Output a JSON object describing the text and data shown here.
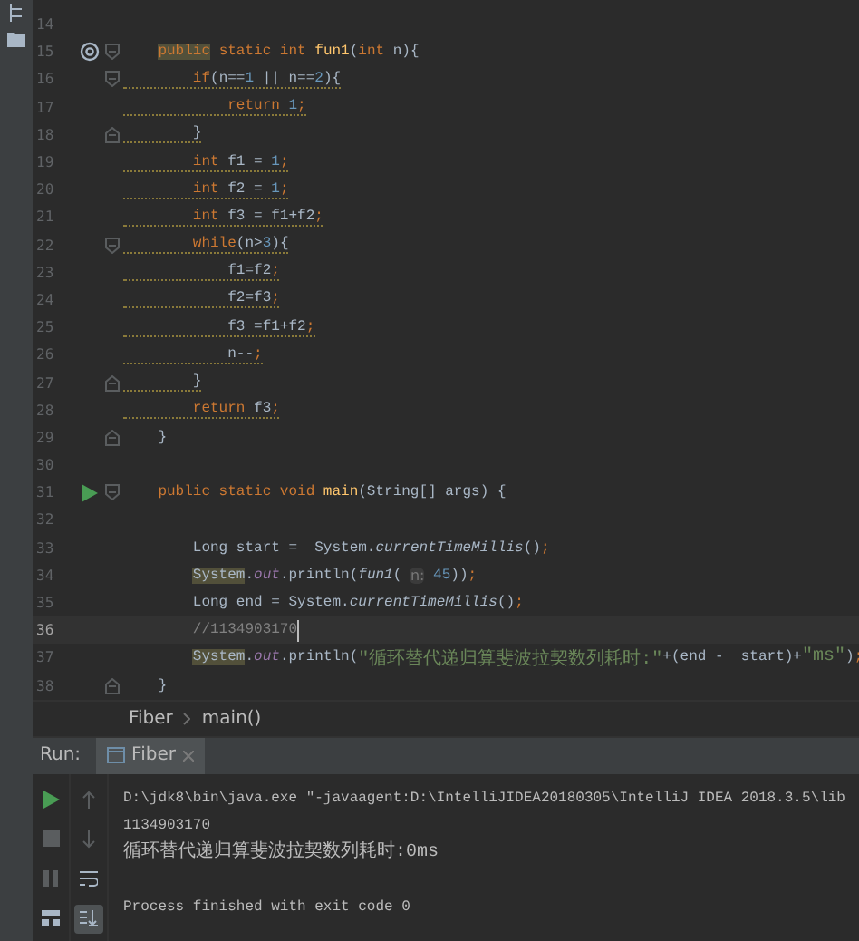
{
  "editor": {
    "lines": [
      {
        "number": "14"
      },
      {
        "number": "15",
        "override": true,
        "fold_start": true,
        "tokens": [
          {
            "kind": "keyword",
            "text": "    public",
            "highlight": true
          },
          {
            "kind": "keyword",
            "text": " static int "
          },
          {
            "kind": "decl",
            "text": "fun1"
          },
          {
            "kind": "plain",
            "text": "("
          },
          {
            "kind": "keyword",
            "text": "int "
          },
          {
            "kind": "plain",
            "text": "n){"
          }
        ]
      },
      {
        "number": "16",
        "fold_start": true,
        "warning": true,
        "tokens": [
          {
            "kind": "keyword",
            "text": "        if"
          },
          {
            "kind": "plain",
            "text": "(n=="
          },
          {
            "kind": "number",
            "text": "1"
          },
          {
            "kind": "plain",
            "text": " || n=="
          },
          {
            "kind": "number",
            "text": "2"
          },
          {
            "kind": "plain",
            "text": "){"
          }
        ]
      },
      {
        "number": "17",
        "warning": true,
        "tokens": [
          {
            "kind": "keyword",
            "text": "            return "
          },
          {
            "kind": "number",
            "text": "1"
          },
          {
            "kind": "keyword",
            "text": ";"
          }
        ]
      },
      {
        "number": "18",
        "fold_end": true,
        "warning": true,
        "tokens": [
          {
            "kind": "plain",
            "text": "        }"
          }
        ]
      },
      {
        "number": "19",
        "warning": true,
        "tokens": [
          {
            "kind": "keyword",
            "text": "        int "
          },
          {
            "kind": "plain",
            "text": "f1 = "
          },
          {
            "kind": "number",
            "text": "1"
          },
          {
            "kind": "keyword",
            "text": ";"
          }
        ]
      },
      {
        "number": "20",
        "warning": true,
        "tokens": [
          {
            "kind": "keyword",
            "text": "        int "
          },
          {
            "kind": "plain",
            "text": "f2 = "
          },
          {
            "kind": "number",
            "text": "1"
          },
          {
            "kind": "keyword",
            "text": ";"
          }
        ]
      },
      {
        "number": "21",
        "warning": true,
        "tokens": [
          {
            "kind": "keyword",
            "text": "        int "
          },
          {
            "kind": "plain",
            "text": "f3 = f1+f2"
          },
          {
            "kind": "keyword",
            "text": ";"
          }
        ]
      },
      {
        "number": "22",
        "fold_start": true,
        "warning": true,
        "tokens": [
          {
            "kind": "keyword",
            "text": "        while"
          },
          {
            "kind": "plain",
            "text": "(n>"
          },
          {
            "kind": "number",
            "text": "3"
          },
          {
            "kind": "plain",
            "text": "){"
          }
        ]
      },
      {
        "number": "23",
        "warning": true,
        "tokens": [
          {
            "kind": "plain",
            "text": "            f1=f2"
          },
          {
            "kind": "keyword",
            "text": ";"
          }
        ]
      },
      {
        "number": "24",
        "warning": true,
        "tokens": [
          {
            "kind": "plain",
            "text": "            f2=f3"
          },
          {
            "kind": "keyword",
            "text": ";"
          }
        ]
      },
      {
        "number": "25",
        "warning": true,
        "tokens": [
          {
            "kind": "plain",
            "text": "            f3 =f1+f2"
          },
          {
            "kind": "keyword",
            "text": ";"
          }
        ]
      },
      {
        "number": "26",
        "warning": true,
        "tokens": [
          {
            "kind": "plain",
            "text": "            n--"
          },
          {
            "kind": "keyword",
            "text": ";"
          }
        ]
      },
      {
        "number": "27",
        "fold_end": true,
        "warning": true,
        "tokens": [
          {
            "kind": "plain",
            "text": "        }"
          }
        ]
      },
      {
        "number": "28",
        "warning": true,
        "tokens": [
          {
            "kind": "keyword",
            "text": "        return "
          },
          {
            "kind": "plain",
            "text": "f3"
          },
          {
            "kind": "keyword",
            "text": ";"
          }
        ]
      },
      {
        "number": "29",
        "fold_end": true,
        "tokens": [
          {
            "kind": "plain",
            "text": "    }"
          }
        ]
      },
      {
        "number": "30"
      },
      {
        "number": "31",
        "run": true,
        "fold_start": true,
        "tokens": [
          {
            "kind": "keyword",
            "text": "    public static void "
          },
          {
            "kind": "decl",
            "text": "main"
          },
          {
            "kind": "plain",
            "text": "(String[] args) {"
          }
        ]
      },
      {
        "number": "32"
      },
      {
        "number": "33",
        "tokens": [
          {
            "kind": "plain",
            "text": "        Long start =  System."
          },
          {
            "kind": "static",
            "text": "currentTimeMillis"
          },
          {
            "kind": "plain",
            "text": "()"
          },
          {
            "kind": "keyword",
            "text": ";"
          }
        ]
      },
      {
        "number": "34",
        "tokens": [
          {
            "kind": "plain",
            "text": "        System",
            "highlight": true
          },
          {
            "kind": "plain",
            "text": "."
          },
          {
            "kind": "field",
            "text": "out"
          },
          {
            "kind": "plain",
            "text": ".println("
          },
          {
            "kind": "static",
            "text": "fun1"
          },
          {
            "kind": "plain",
            "text": "( "
          },
          {
            "kind": "hint",
            "text": "n:"
          },
          {
            "kind": "number",
            "text": " 45"
          },
          {
            "kind": "plain",
            "text": "))"
          },
          {
            "kind": "keyword",
            "text": ";"
          }
        ]
      },
      {
        "number": "35",
        "tokens": [
          {
            "kind": "plain",
            "text": "        Long end = System."
          },
          {
            "kind": "static",
            "text": "currentTimeMillis"
          },
          {
            "kind": "plain",
            "text": "()"
          },
          {
            "kind": "keyword",
            "text": ";"
          }
        ]
      },
      {
        "number": "36",
        "current": true,
        "tokens": [
          {
            "kind": "comment",
            "text": "        //1134903170"
          }
        ]
      },
      {
        "number": "37",
        "tokens": [
          {
            "kind": "plain",
            "text": "        System",
            "highlight": true
          },
          {
            "kind": "plain",
            "text": "."
          },
          {
            "kind": "field",
            "text": "out"
          },
          {
            "kind": "plain",
            "text": ".println("
          },
          {
            "kind": "string",
            "text": "\"循环替代递归算斐波拉契数列耗时:\""
          },
          {
            "kind": "plain",
            "text": "+(end -  start)+"
          },
          {
            "kind": "string",
            "text": "\"ms\""
          },
          {
            "kind": "plain",
            "text": ")"
          },
          {
            "kind": "keyword",
            "text": ";"
          }
        ]
      },
      {
        "number": "38",
        "fold_end": true,
        "tokens": [
          {
            "kind": "plain",
            "text": "    }"
          }
        ]
      }
    ]
  },
  "breadcrumbs": [
    {
      "label": "Fiber"
    },
    {
      "label": "main()"
    }
  ],
  "run_panel": {
    "title": "Run:",
    "tabs": [
      {
        "label": "Fiber",
        "selected": true
      }
    ],
    "console": [
      {
        "kind": "command",
        "text": "D:\\jdk8\\bin\\java.exe \"-javaagent:D:\\IntelliJIDEA20180305\\IntelliJ IDEA 2018.3.5\\lib"
      },
      {
        "kind": "output",
        "text": "1134903170"
      },
      {
        "kind": "output",
        "text": "循环替代递归算斐波拉契数列耗时:0ms"
      },
      {
        "kind": "blank"
      },
      {
        "kind": "output",
        "text": "Process finished with exit code 0"
      }
    ]
  }
}
